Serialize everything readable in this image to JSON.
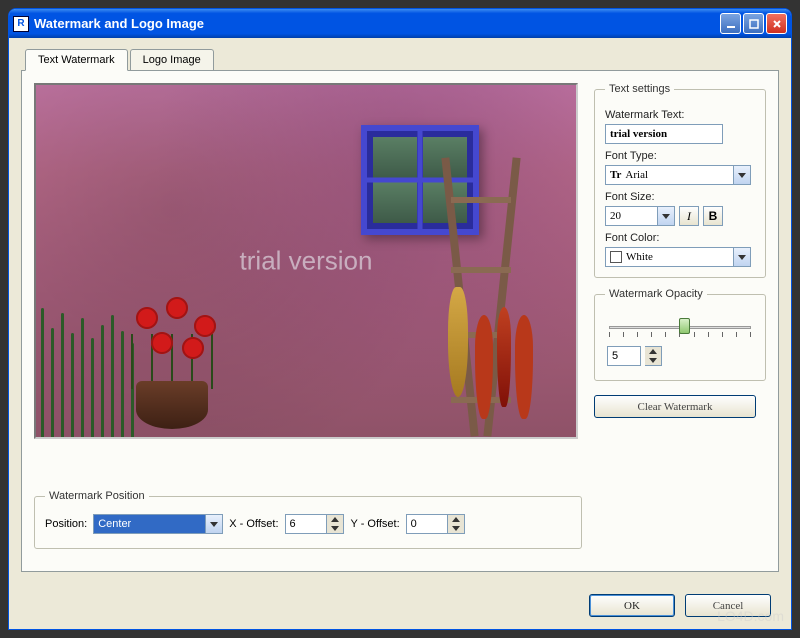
{
  "window": {
    "title": "Watermark and Logo Image",
    "app_icon_letter": "R"
  },
  "tabs": {
    "text": "Text Watermark",
    "logo": "Logo Image",
    "active": "text"
  },
  "preview": {
    "watermark_overlay": "trial version"
  },
  "text_settings": {
    "legend": "Text settings",
    "watermark_label": "Watermark Text:",
    "watermark_value": "trial version",
    "font_type_label": "Font Type:",
    "font_type_value": "Arial",
    "font_type_icon": "Tr",
    "font_size_label": "Font Size:",
    "font_size_value": "20",
    "italic_label": "I",
    "bold_label": "B",
    "font_color_label": "Font Color:",
    "font_color_value": "White",
    "font_color_hex": "#ffffff"
  },
  "opacity": {
    "legend": "Watermark Opacity",
    "value": "5",
    "min": 0,
    "max": 10,
    "tick_count": 11
  },
  "clear_button": "Clear Watermark",
  "position": {
    "legend": "Watermark Position",
    "label": "Position:",
    "value": "Center",
    "x_offset_label": "X - Offset:",
    "x_offset_value": "6",
    "y_offset_label": "Y - Offset:",
    "y_offset_value": "0"
  },
  "dialog_buttons": {
    "ok": "OK",
    "cancel": "Cancel"
  },
  "site_watermark": "LO4D.com"
}
